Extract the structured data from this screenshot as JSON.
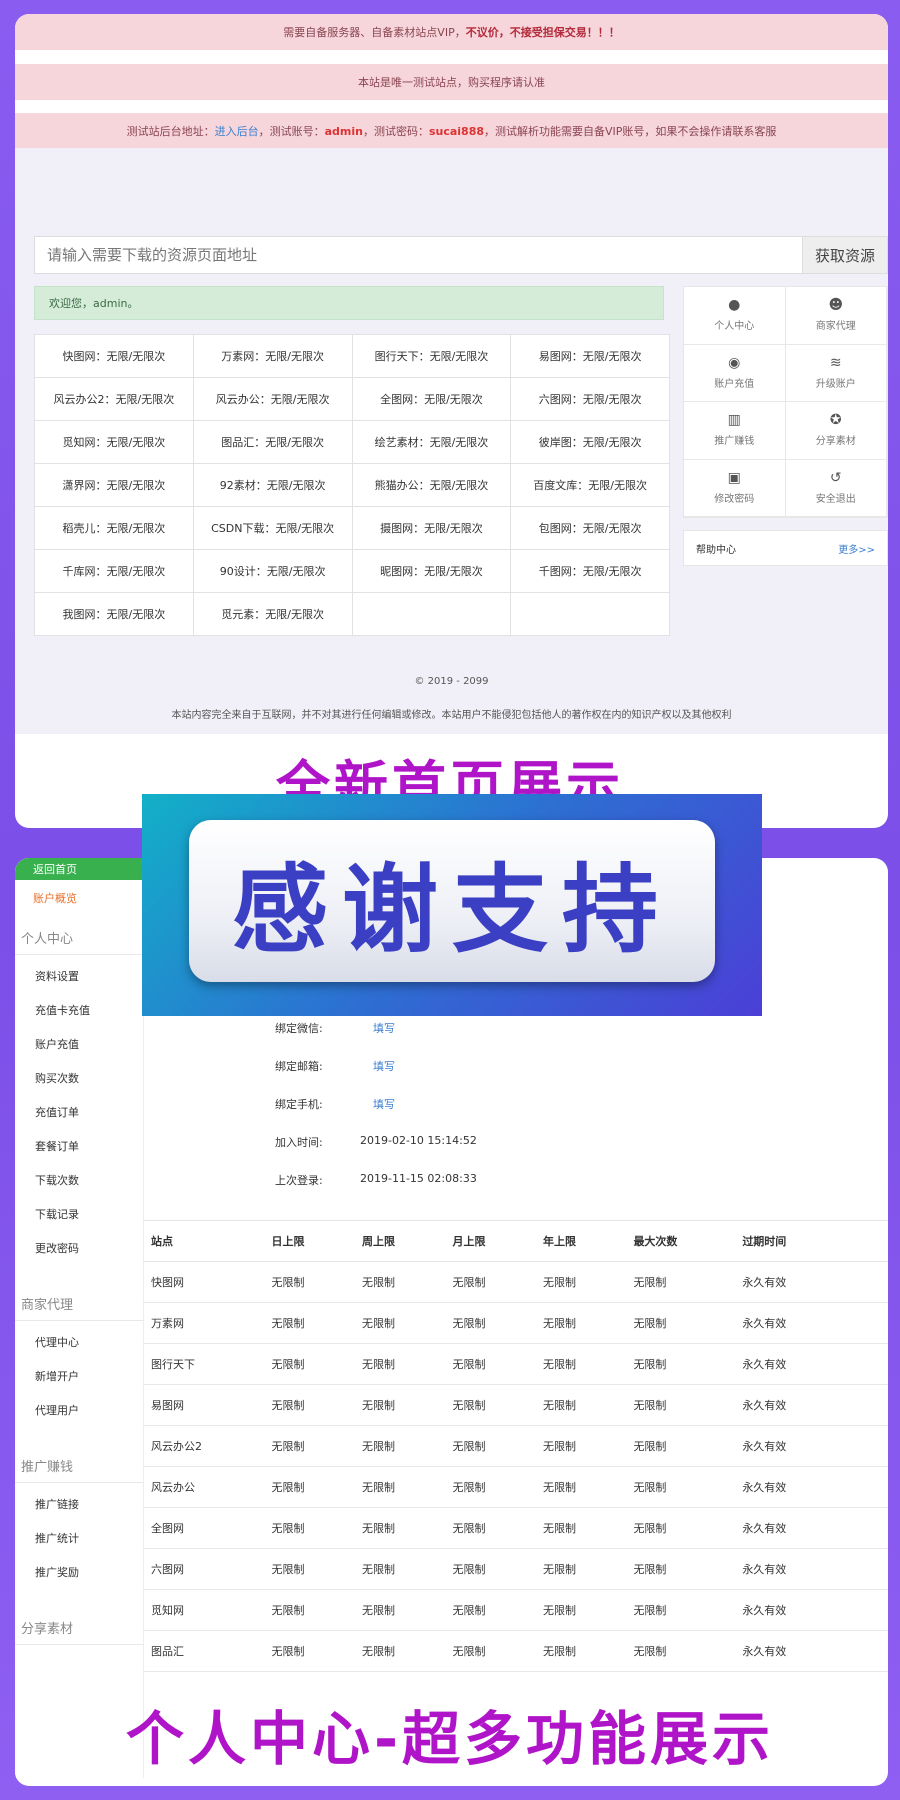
{
  "notices": {
    "n1_text": "需要自备服务器、自备素材站点VIP，",
    "n1_bold": "不议价，不接受担保交易！！！",
    "n2": "本站是唯一测试站点，购买程序请认准",
    "n3_prefix": "测试站后台地址：",
    "n3_link": "进入后台",
    "n3_account_label": "，测试账号：",
    "n3_account": "admin",
    "n3_pwd_label": "，测试密码：",
    "n3_pwd": "sucai888",
    "n3_suffix": "，测试解析功能需要自备VIP账号，如果不会操作请联系客服"
  },
  "search": {
    "placeholder": "请输入需要下载的资源页面地址",
    "button": "获取资源"
  },
  "welcome": "欢迎您，admin。",
  "sites": [
    [
      "快图网：无限/无限次",
      "万素网：无限/无限次",
      "图行天下：无限/无限次",
      "易图网：无限/无限次"
    ],
    [
      "风云办公2：无限/无限次",
      "风云办公：无限/无限次",
      "全图网：无限/无限次",
      "六图网：无限/无限次"
    ],
    [
      "觅知网：无限/无限次",
      "图品汇：无限/无限次",
      "绘艺素材：无限/无限次",
      "彼岸图：无限/无限次"
    ],
    [
      "潇界网：无限/无限次",
      "92素材：无限/无限次",
      "熊猫办公：无限/无限次",
      "百度文库：无限/无限次"
    ],
    [
      "稻壳儿：无限/无限次",
      "CSDN下载：无限/无限次",
      "摄图网：无限/无限次",
      "包图网：无限/无限次"
    ],
    [
      "千库网：无限/无限次",
      "90设计：无限/无限次",
      "昵图网：无限/无限次",
      "千图网：无限/无限次"
    ],
    [
      "我图网：无限/无限次",
      "觅元素：无限/无限次",
      "",
      ""
    ]
  ],
  "panel": [
    {
      "label": "个人中心",
      "icon": "user-icon"
    },
    {
      "label": "商家代理",
      "icon": "group-icon"
    },
    {
      "label": "账户充值",
      "icon": "coin-icon"
    },
    {
      "label": "升级账户",
      "icon": "layers-icon"
    },
    {
      "label": "推广赚钱",
      "icon": "chart-icon"
    },
    {
      "label": "分享素材",
      "icon": "share-icon"
    },
    {
      "label": "修改密码",
      "icon": "lock-icon"
    },
    {
      "label": "安全退出",
      "icon": "logout-icon"
    }
  ],
  "help": {
    "title": "帮助中心",
    "more": "更多>>"
  },
  "footer": {
    "copyright": "© 2019 - 2099",
    "disclaimer": "本站内容完全来自于互联网，并不对其进行任何编辑或修改。本站用户不能侵犯包括他人的著作权在内的知识产权以及其他权利"
  },
  "titles": {
    "top": "全新首页展示",
    "badge": "感谢支持",
    "bottom": "个人中心-超多功能展示"
  },
  "nav": {
    "home": "返回首页",
    "overview": "账户概览",
    "sections": [
      {
        "title": "个人中心",
        "items": [
          "资料设置",
          "充值卡充值",
          "账户充值",
          "购买次数",
          "充值订单",
          "套餐订单",
          "下载次数",
          "下载记录",
          "更改密码"
        ]
      },
      {
        "title": "商家代理",
        "items": [
          "代理中心",
          "新增开户",
          "代理用户"
        ]
      },
      {
        "title": "推广赚钱",
        "items": [
          "推广链接",
          "推广统计",
          "推广奖励"
        ]
      },
      {
        "title": "分享素材",
        "items": []
      }
    ]
  },
  "profile": [
    {
      "label": "绑定微信:",
      "value": "填写",
      "fill": true
    },
    {
      "label": "绑定邮箱:",
      "value": "填写",
      "fill": true
    },
    {
      "label": "绑定手机:",
      "value": "填写",
      "fill": true
    },
    {
      "label": "加入时间:",
      "value": "2019-02-10 15:14:52",
      "fill": false
    },
    {
      "label": "上次登录:",
      "value": "2019-11-15 02:08:33",
      "fill": false
    }
  ],
  "limits": {
    "headers": [
      "站点",
      "日上限",
      "周上限",
      "月上限",
      "年上限",
      "最大次数",
      "过期时间"
    ],
    "rows": [
      [
        "快图网",
        "无限制",
        "无限制",
        "无限制",
        "无限制",
        "无限制",
        "永久有效"
      ],
      [
        "万素网",
        "无限制",
        "无限制",
        "无限制",
        "无限制",
        "无限制",
        "永久有效"
      ],
      [
        "图行天下",
        "无限制",
        "无限制",
        "无限制",
        "无限制",
        "无限制",
        "永久有效"
      ],
      [
        "易图网",
        "无限制",
        "无限制",
        "无限制",
        "无限制",
        "无限制",
        "永久有效"
      ],
      [
        "风云办公2",
        "无限制",
        "无限制",
        "无限制",
        "无限制",
        "无限制",
        "永久有效"
      ],
      [
        "风云办公",
        "无限制",
        "无限制",
        "无限制",
        "无限制",
        "无限制",
        "永久有效"
      ],
      [
        "全图网",
        "无限制",
        "无限制",
        "无限制",
        "无限制",
        "无限制",
        "永久有效"
      ],
      [
        "六图网",
        "无限制",
        "无限制",
        "无限制",
        "无限制",
        "无限制",
        "永久有效"
      ],
      [
        "觅知网",
        "无限制",
        "无限制",
        "无限制",
        "无限制",
        "无限制",
        "永久有效"
      ],
      [
        "图品汇",
        "无限制",
        "无限制",
        "无限制",
        "无限制",
        "无限制",
        "永久有效"
      ]
    ]
  },
  "colors": {
    "accent_purple": "#b014c8",
    "link_blue": "#3a7fd0",
    "nav_green": "#39b04e"
  }
}
